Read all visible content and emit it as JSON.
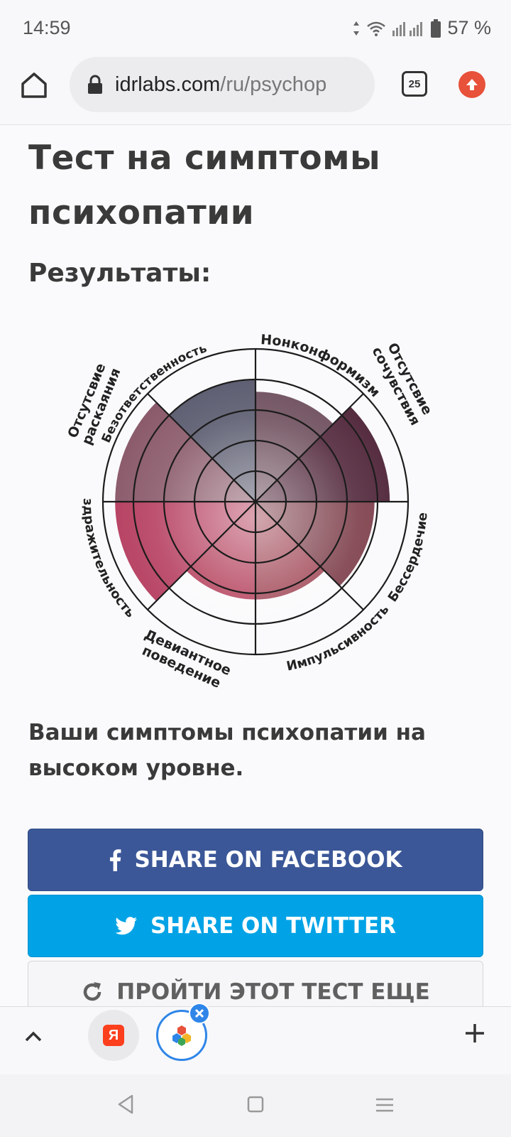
{
  "status_bar": {
    "time": "14:59",
    "battery": "57 %"
  },
  "browser": {
    "url_host": "idrlabs.com",
    "url_path": "/ru/psychop",
    "tab_count": "25"
  },
  "page": {
    "title": "Тест на симптомы психопатии",
    "results_heading": "Результаты:",
    "result_text": "Ваши симптомы психопатии на высоком уровне."
  },
  "radar": {
    "labels": {
      "bezotvetstvennost": "Безответственность",
      "nonkonformizm": "Нонконформизм",
      "sochuvstvie_1": "Отсутсвие",
      "sochuvstvie_2": "сочувствия",
      "besserdechie": "Бессердечие",
      "impulsivnost": "Импульсивность",
      "deviantnoe_1": "Девиантное",
      "deviantnoe_2": "поведение",
      "razdrazhitelnost": "Раздражительность",
      "raskayanie_1": "Отсутсвие",
      "raskayanie_2": "раскаяния"
    },
    "scale_max": 5,
    "scores": {
      "bezotvetstvennost": 4,
      "nonkonformizm": 3.6,
      "sochuvstvie": 4.4,
      "besserdechie": 3.9,
      "impulsivnost": 3.2,
      "deviantnoe": 3.2,
      "razdrazhitelnost": 4.6,
      "raskayanie": 4.6
    },
    "colors": {
      "bezotvetstvennost": "#55566a",
      "nonkonformizm": "#6a4a58",
      "sochuvstvie": "#4e2337",
      "besserdechie": "#7a3a46",
      "impulsivnost": "#9c3e4e",
      "deviantnoe": "#b03653",
      "razdrazhitelnost": "#b43a5c",
      "raskayanie": "#875566"
    }
  },
  "buttons": {
    "facebook": "SHARE ON FACEBOOK",
    "twitter": "SHARE ON TWITTER",
    "retry": "ПРОЙТИ ЭТОТ ТЕСТ ЕЩЕ"
  },
  "bottom_toolbar": {
    "yandex_tab_letter": "Я"
  },
  "icons": {
    "home": "home-icon",
    "lock": "lock-icon",
    "update": "arrow-up-icon",
    "facebook": "facebook-icon",
    "twitter": "twitter-icon",
    "retry": "refresh-icon",
    "chevron": "chevron-up-icon",
    "plus": "plus-icon",
    "close": "close-icon"
  }
}
